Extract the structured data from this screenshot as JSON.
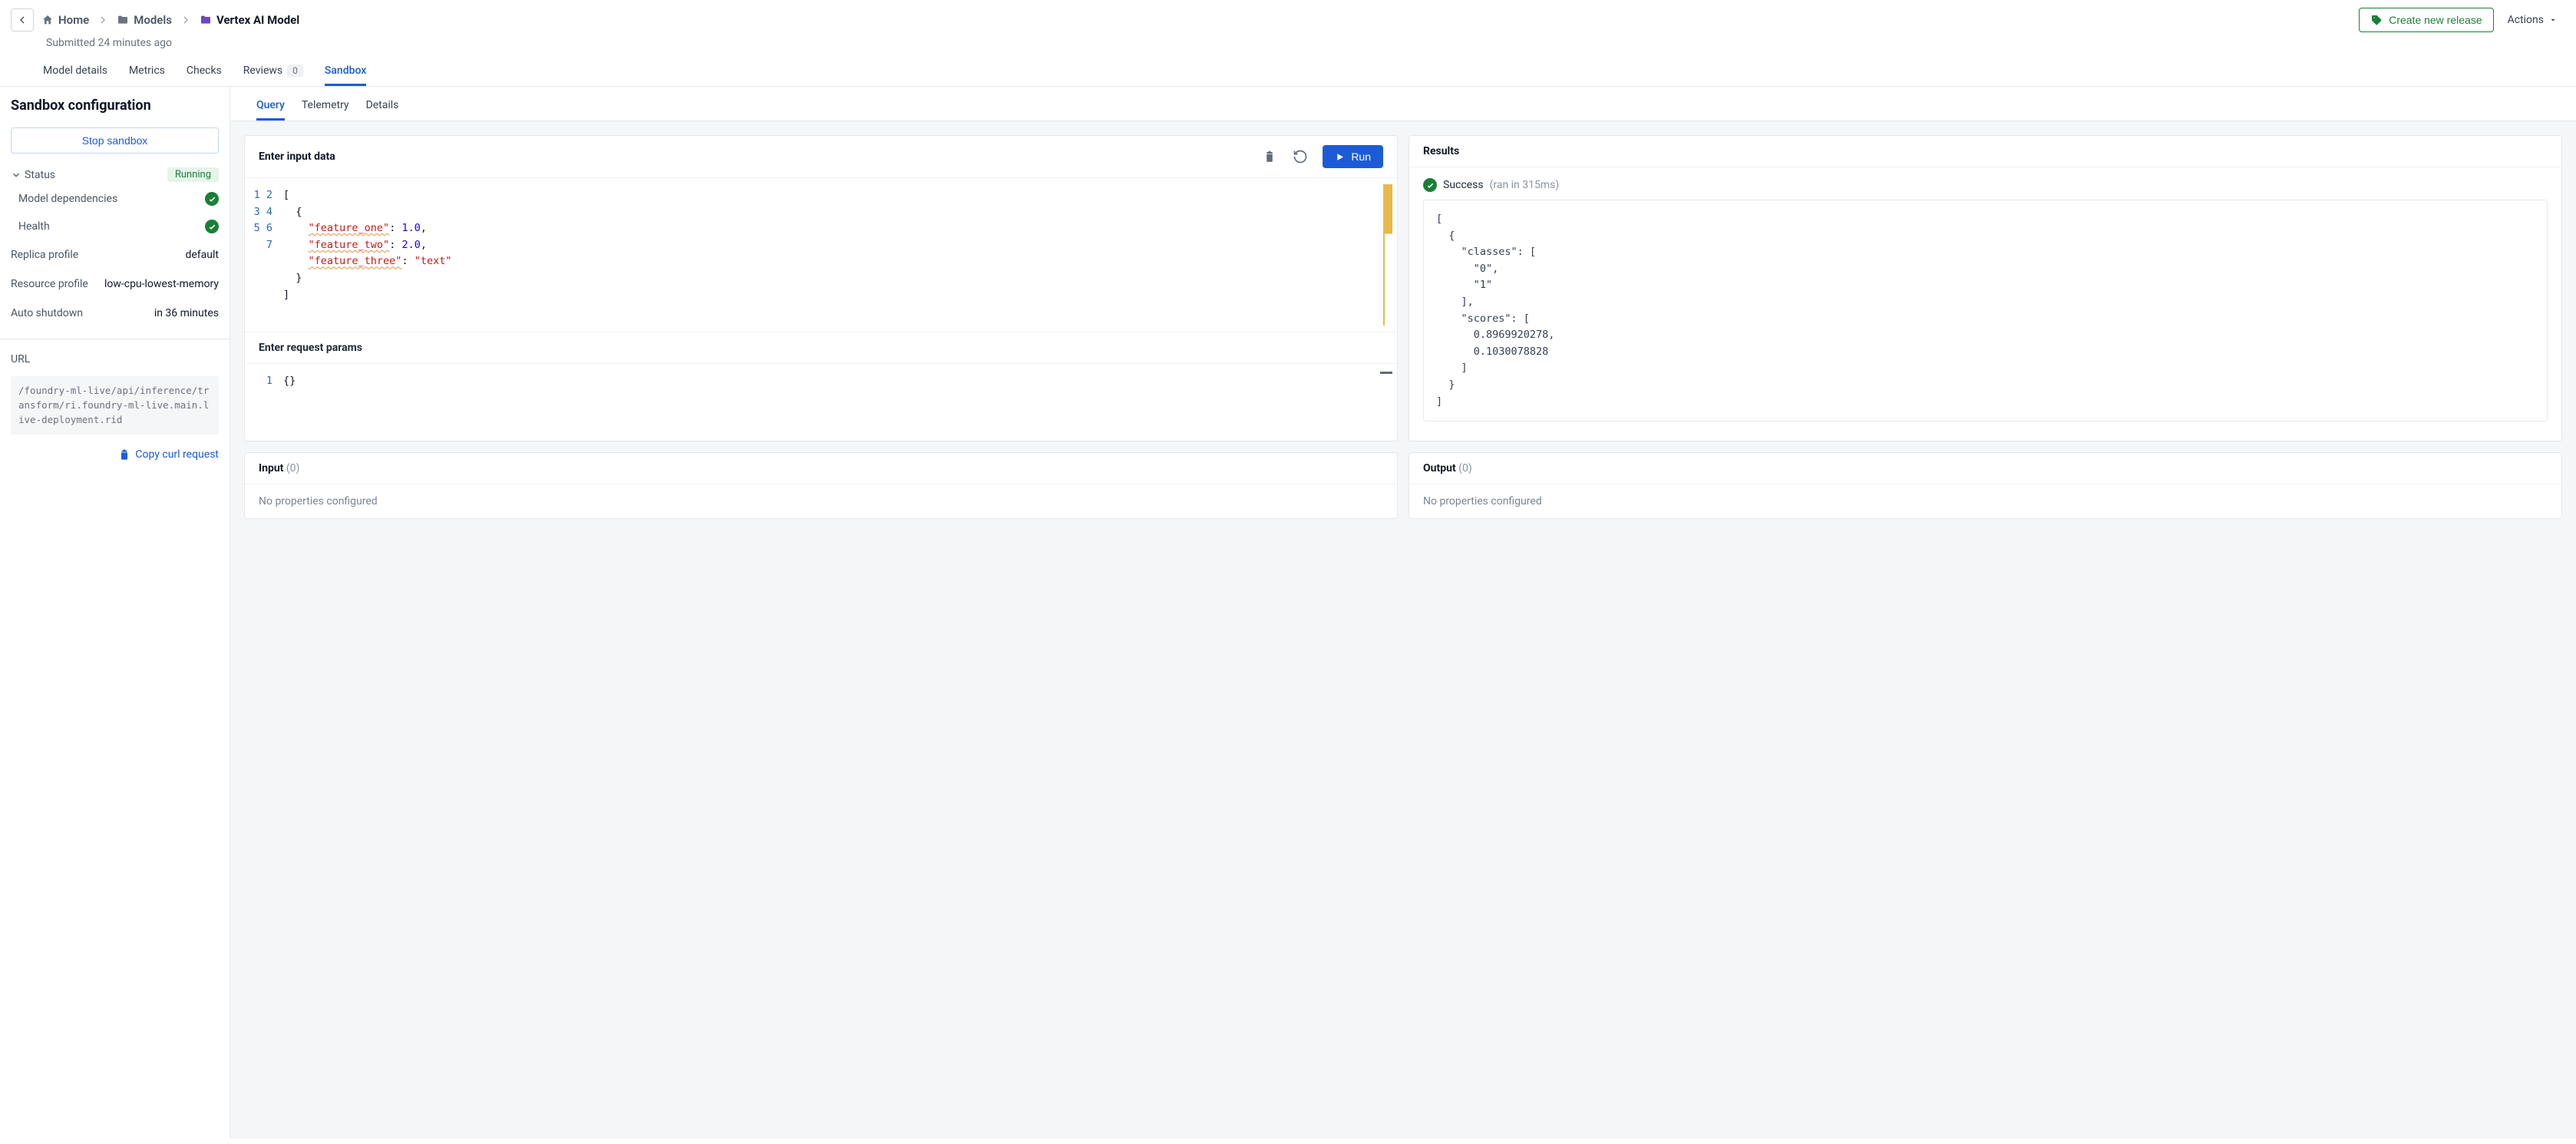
{
  "breadcrumb": {
    "home": "Home",
    "models": "Models",
    "current": "Vertex AI Model"
  },
  "submitted_text": "Submitted 24 minutes ago",
  "top_actions": {
    "create_release": "Create new release",
    "actions": "Actions"
  },
  "main_tabs": {
    "model_details": "Model details",
    "metrics": "Metrics",
    "checks": "Checks",
    "reviews": "Reviews",
    "reviews_count": "0",
    "sandbox": "Sandbox"
  },
  "sidebar": {
    "title": "Sandbox configuration",
    "stop_btn": "Stop sandbox",
    "status_label": "Status",
    "running_badge": "Running",
    "model_deps": "Model dependencies",
    "health": "Health",
    "replica_profile_label": "Replica profile",
    "replica_profile_value": "default",
    "resource_profile_label": "Resource profile",
    "resource_profile_value": "low-cpu-lowest-memory",
    "auto_shutdown_label": "Auto shutdown",
    "auto_shutdown_value": "in 36 minutes",
    "url_label": "URL",
    "url_value": "/foundry-ml-live/api/inference/transform/ri.foundry-ml-live.main.live-deployment.rid",
    "copy_curl": "Copy curl request"
  },
  "sub_tabs": {
    "query": "Query",
    "telemetry": "Telemetry",
    "details": "Details"
  },
  "input_panel": {
    "header": "Enter input data",
    "run_label": "Run",
    "code": {
      "l1": "[",
      "l2": "  {",
      "l3a": "    ",
      "l3b": "\"feature_one\"",
      "l3c": ": ",
      "l3d": "1.0",
      "l3e": ",",
      "l4b": "\"feature_two\"",
      "l4d": "2.0",
      "l5b": "\"feature_three\"",
      "l5d": "\"text\"",
      "l6": "  }",
      "l7": "]",
      "lines": [
        "1",
        "2",
        "3",
        "4",
        "5",
        "6",
        "7"
      ]
    },
    "request_params_header": "Enter request params",
    "params_line_no": "1",
    "params_code": "{}"
  },
  "results_panel": {
    "header": "Results",
    "success_label": "Success",
    "ran_text": "(ran in 315ms)",
    "json": "[\n  {\n    \"classes\": [\n      \"0\",\n      \"1\"\n    ],\n    \"scores\": [\n      0.8969920278,\n      0.1030078828\n    ]\n  }\n]"
  },
  "io_panels": {
    "input_label": "Input",
    "input_count": "(0)",
    "output_label": "Output",
    "output_count": "(0)",
    "none_msg": "No properties configured"
  }
}
